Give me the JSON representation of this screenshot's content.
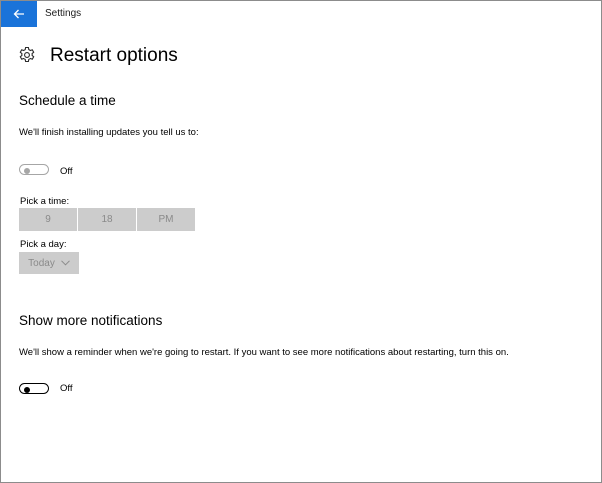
{
  "window": {
    "title": "Settings"
  },
  "page": {
    "title": "Restart options"
  },
  "schedule": {
    "heading": "Schedule a time",
    "description": "We'll finish installing updates you tell us to:",
    "toggle_label": "Off",
    "pick_time_label": "Pick a time:",
    "time": {
      "hour": "9",
      "minute": "18",
      "period": "PM"
    },
    "pick_day_label": "Pick a day:",
    "day": "Today"
  },
  "notifications": {
    "heading": "Show more notifications",
    "description": "We'll show a reminder when we're going to restart. If you want to see more notifications about restarting, turn this on.",
    "toggle_label": "Off"
  },
  "colors": {
    "accent": "#1a73d9",
    "disabled_fill": "#cccccc",
    "disabled_text": "#8a8a8a"
  },
  "icons": {
    "back": "back-arrow-icon",
    "settings": "gear-icon",
    "dropdown": "chevron-down-icon"
  }
}
